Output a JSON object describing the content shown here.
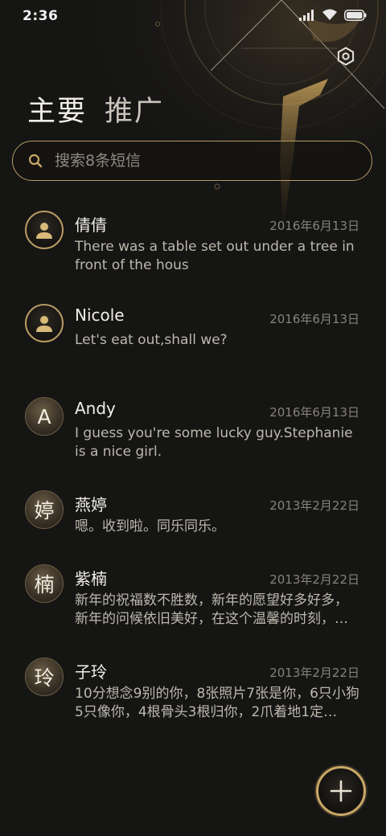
{
  "status_bar": {
    "time": "2:36"
  },
  "tabs": [
    {
      "label": "主要",
      "active": true
    },
    {
      "label": "推广",
      "active": false
    }
  ],
  "search": {
    "placeholder": "搜索8条短信",
    "value": ""
  },
  "conversations": [
    {
      "avatar_type": "person-icon",
      "avatar_text": "",
      "name": "倩倩",
      "date": "2016年6月13日",
      "preview": "There was a table set out under a tree in front of the hous"
    },
    {
      "avatar_type": "person-icon",
      "avatar_text": "",
      "name": "Nicole",
      "date": "2016年6月13日",
      "preview": "Let's eat out,shall we?"
    },
    {
      "avatar_type": "letter",
      "avatar_text": "A",
      "name": "Andy",
      "date": "2016年6月13日",
      "preview": "I guess you're some lucky guy.Stephanie is a nice girl."
    },
    {
      "avatar_type": "letter",
      "avatar_text": "婷",
      "name": "燕婷",
      "date": "2013年2月22日",
      "preview": "嗯。收到啦。同乐同乐。"
    },
    {
      "avatar_type": "letter",
      "avatar_text": "楠",
      "name": "紫楠",
      "date": "2013年2月22日",
      "preview": "新年的祝福数不胜数，新年的愿望好多好多，新年的问候依旧美好，在这个温馨的时刻，…"
    },
    {
      "avatar_type": "letter",
      "avatar_text": "玲",
      "name": "子玲",
      "date": "2013年2月22日",
      "preview": "10分想念9别的你，8张照片7张是你，6只小狗5只像你，4根骨头3根归你，2爪着地1定…"
    }
  ],
  "icons": {
    "settings": "settings-icon",
    "search": "search-icon",
    "compose": "plus-icon",
    "person": "person-icon"
  },
  "colors": {
    "background": "#151514",
    "accent_gold": "#c9a866",
    "text_primary": "#f1eee7",
    "text_secondary": "#bdb8ae",
    "text_date": "#86827a"
  }
}
